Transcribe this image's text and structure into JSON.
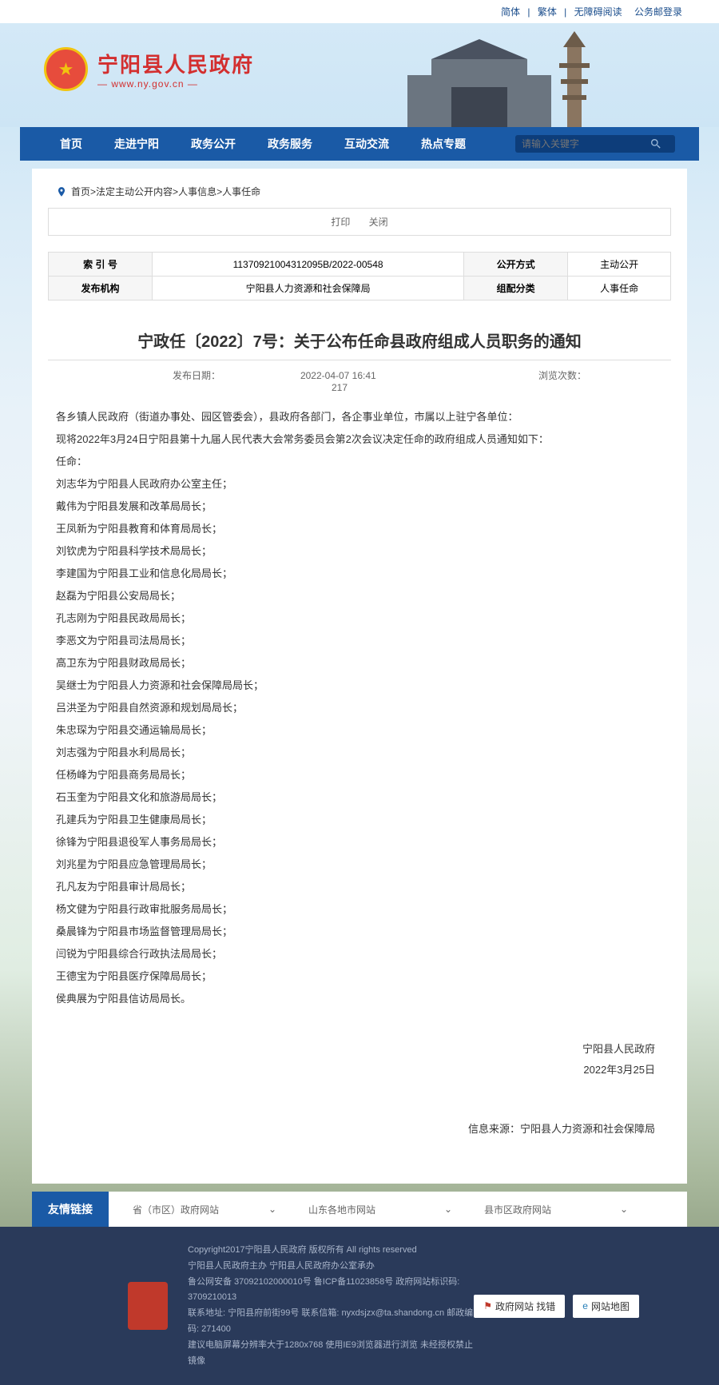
{
  "topbar": {
    "simplified": "简体",
    "traditional": "繁体",
    "accessibility": "无障碍阅读",
    "login": "公务邮登录"
  },
  "site": {
    "title": "宁阳县人民政府",
    "url": "— www.ny.gov.cn —"
  },
  "nav": {
    "items": [
      "首页",
      "走进宁阳",
      "政务公开",
      "政务服务",
      "互动交流",
      "热点专题"
    ],
    "search_placeholder": "请输入关键字"
  },
  "breadcrumb": {
    "home": "首页",
    "p1": "法定主动公开内容",
    "p2": "人事信息",
    "p3": "人事任命"
  },
  "actions": {
    "print": "打印",
    "close": "关闭"
  },
  "meta": {
    "label_index": "索 引 号",
    "index": "11370921004312095B/2022-00548",
    "label_method": "公开方式",
    "method": "主动公开",
    "label_org": "发布机构",
    "org": "宁阳县人力资源和社会保障局",
    "label_category": "组配分类",
    "category": "人事任命"
  },
  "article": {
    "title": "宁政任〔2022〕7号：关于公布任命县政府组成人员职务的通知",
    "date_label": "发布日期：",
    "date": "2022-04-07 16:41",
    "views_label": "浏览次数：",
    "views": "217",
    "intro1": "各乡镇人民政府（街道办事处、园区管委会），县政府各部门，各企事业单位，市属以上驻宁各单位：",
    "intro2": "现将2022年3月24日宁阳县第十九届人民代表大会常务委员会第2次会议决定任命的政府组成人员通知如下：",
    "appoint_label": "任命：",
    "lines": [
      "刘志华为宁阳县人民政府办公室主任；",
      "戴伟为宁阳县发展和改革局局长；",
      "王凤新为宁阳县教育和体育局局长；",
      "刘钦虎为宁阳县科学技术局局长；",
      "李建国为宁阳县工业和信息化局局长；",
      "赵磊为宁阳县公安局局长；",
      "孔志刚为宁阳县民政局局长；",
      "李恶文为宁阳县司法局局长；",
      "高卫东为宁阳县财政局局长；",
      "吴继士为宁阳县人力资源和社会保障局局长；",
      "吕洪圣为宁阳县自然资源和规划局局长；",
      "朱忠琛为宁阳县交通运输局局长；",
      "刘志强为宁阳县水利局局长；",
      "任杨峰为宁阳县商务局局长；",
      "石玉奎为宁阳县文化和旅游局局长；",
      "孔建兵为宁阳县卫生健康局局长；",
      "徐锋为宁阳县退役军人事务局局长；",
      "刘兆星为宁阳县应急管理局局长；",
      "孔凡友为宁阳县审计局局长；",
      "杨文健为宁阳县行政审批服务局局长；",
      "桑晨锋为宁阳县市场监督管理局局长；",
      "闫锐为宁阳县综合行政执法局局长；",
      "王德宝为宁阳县医疗保障局局长；",
      "侯典展为宁阳县信访局局长。"
    ],
    "sign_org": "宁阳县人民政府",
    "sign_date": "2022年3月25日",
    "source_label": "信息来源：",
    "source": "宁阳县人力资源和社会保障局"
  },
  "links": {
    "title": "友情链接",
    "opts": [
      "省（市区）政府网站",
      "山东各地市网站",
      "县市区政府网站"
    ]
  },
  "footer": {
    "l1": "Copyright2017宁阳县人民政府 版权所有 All rights reserved",
    "l2": "宁阳县人民政府主办 宁阳县人民政府办公室承办",
    "l3": "鲁公网安备 37092102000010号 鲁ICP备11023858号 政府网站标识码: 3709210013",
    "l4": "联系地址: 宁阳县府前街99号 联系信箱: nyxdsjzx@ta.shandong.cn 邮政编码: 271400",
    "l5": "建议电脑屏幕分辨率大于1280x768 使用IE9浏览器进行浏览 未经授权禁止镜像",
    "badge1": "政府网站\n找错",
    "badge2": "网站地图"
  }
}
